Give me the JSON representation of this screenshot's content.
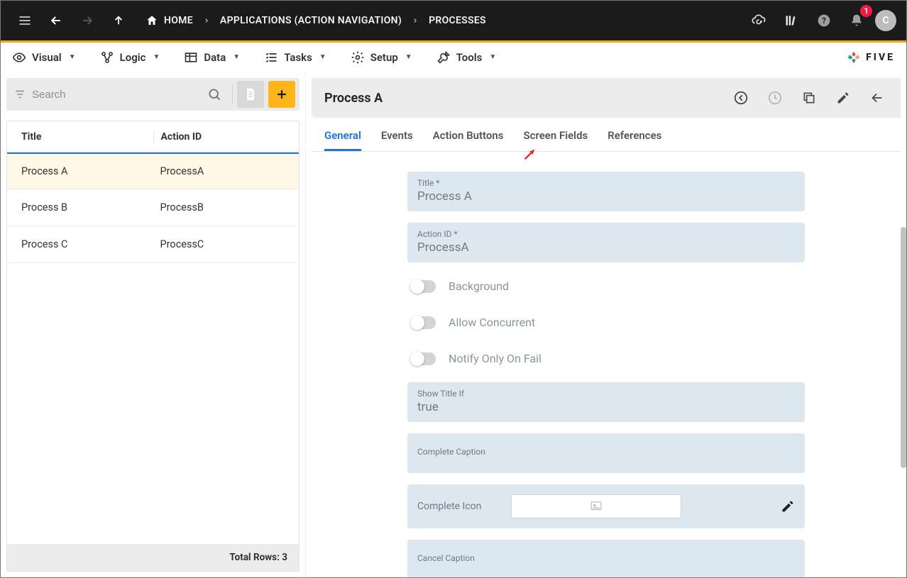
{
  "topbar": {
    "breadcrumbs": [
      {
        "label": "HOME",
        "has_home_icon": true
      },
      {
        "label": "APPLICATIONS (ACTION NAVIGATION)"
      },
      {
        "label": "PROCESSES"
      }
    ],
    "notification_count": "1",
    "avatar_initial": "C"
  },
  "menubar": {
    "items": [
      {
        "label": "Visual",
        "icon": "eye"
      },
      {
        "label": "Logic",
        "icon": "logic"
      },
      {
        "label": "Data",
        "icon": "table"
      },
      {
        "label": "Tasks",
        "icon": "checklist"
      },
      {
        "label": "Setup",
        "icon": "gear"
      },
      {
        "label": "Tools",
        "icon": "wrench"
      }
    ],
    "brand": "FIVE"
  },
  "left": {
    "search_placeholder": "Search",
    "columns": {
      "title": "Title",
      "action_id": "Action ID"
    },
    "rows": [
      {
        "title": "Process A",
        "action_id": "ProcessA",
        "selected": true
      },
      {
        "title": "Process B",
        "action_id": "ProcessB",
        "selected": false
      },
      {
        "title": "Process C",
        "action_id": "ProcessC",
        "selected": false
      }
    ],
    "footer": "Total Rows: 3"
  },
  "right": {
    "title": "Process A",
    "tabs": [
      {
        "label": "General",
        "active": true
      },
      {
        "label": "Events"
      },
      {
        "label": "Action Buttons"
      },
      {
        "label": "Screen Fields"
      },
      {
        "label": "References"
      }
    ],
    "form": {
      "title_label": "Title *",
      "title_value": "Process A",
      "action_id_label": "Action ID *",
      "action_id_value": "ProcessA",
      "background_label": "Background",
      "background_value": false,
      "allow_concurrent_label": "Allow Concurrent",
      "allow_concurrent_value": false,
      "notify_fail_label": "Notify Only On Fail",
      "notify_fail_value": false,
      "show_title_if_label": "Show Title If",
      "show_title_if_value": "true",
      "complete_caption_label": "Complete Caption",
      "complete_caption_value": "",
      "complete_icon_label": "Complete Icon",
      "cancel_caption_label": "Cancel Caption",
      "cancel_caption_value": ""
    }
  }
}
